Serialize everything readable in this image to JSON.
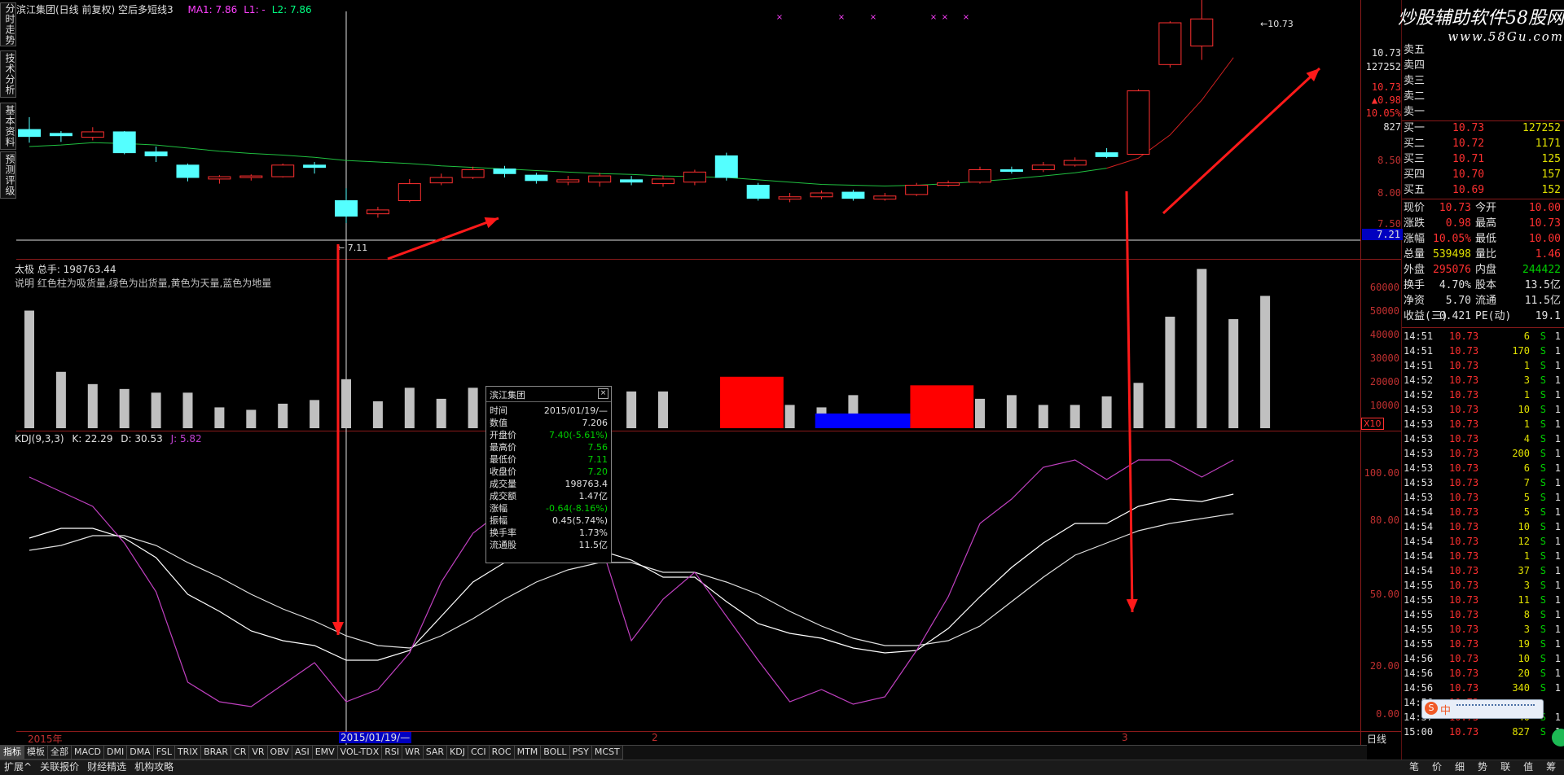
{
  "chart_header": {
    "title": "滨江集团(日线 前复权) 空后多短线3",
    "ma_labels": [
      {
        "text": "MA1: 7.86",
        "color": "#ff40ff"
      },
      {
        "text": "L1: -",
        "color": "#ff40ff"
      },
      {
        "text": "L2: 7.86",
        "color": "#00ff80"
      }
    ]
  },
  "side_tabs": [
    "分时走势",
    "技术分析",
    "基本资料",
    "预测评级"
  ],
  "watermark": {
    "line1": "炒股辅助软件58股网",
    "line2": "www.58Gu.com"
  },
  "price_axis": {
    "ticks": [
      "10.73",
      "127252",
      "10.73",
      "▲0.98",
      "10.05%",
      "827",
      "8.50",
      "8.00",
      "7.50",
      "7.21"
    ]
  },
  "price_chart": {
    "high_label": "10.73",
    "low_label": "← 7.11",
    "x_markers": [
      "×",
      "×",
      "×",
      "×",
      "×",
      "×"
    ],
    "candles": [
      {
        "o": 8.32,
        "c": 8.23,
        "h": 8.48,
        "l": 8.15
      },
      {
        "o": 8.27,
        "c": 8.24,
        "h": 8.3,
        "l": 8.16
      },
      {
        "o": 8.22,
        "c": 8.29,
        "h": 8.35,
        "l": 8.18
      },
      {
        "o": 8.29,
        "c": 8.02,
        "h": 8.3,
        "l": 8.0
      },
      {
        "o": 8.03,
        "c": 7.98,
        "h": 8.1,
        "l": 7.9
      },
      {
        "o": 7.86,
        "c": 7.7,
        "h": 7.88,
        "l": 7.65
      },
      {
        "o": 7.68,
        "c": 7.71,
        "h": 7.73,
        "l": 7.62
      },
      {
        "o": 7.7,
        "c": 7.72,
        "h": 7.74,
        "l": 7.66
      },
      {
        "o": 7.71,
        "c": 7.86,
        "h": 7.88,
        "l": 7.7
      },
      {
        "o": 7.86,
        "c": 7.83,
        "h": 7.9,
        "l": 7.75
      },
      {
        "o": 7.4,
        "c": 7.2,
        "h": 7.56,
        "l": 7.11
      },
      {
        "o": 7.23,
        "c": 7.28,
        "h": 7.32,
        "l": 7.18
      },
      {
        "o": 7.4,
        "c": 7.62,
        "h": 7.68,
        "l": 7.38
      },
      {
        "o": 7.63,
        "c": 7.7,
        "h": 7.75,
        "l": 7.6
      },
      {
        "o": 7.7,
        "c": 7.8,
        "h": 7.84,
        "l": 7.68
      },
      {
        "o": 7.81,
        "c": 7.75,
        "h": 7.85,
        "l": 7.7
      },
      {
        "o": 7.73,
        "c": 7.66,
        "h": 7.76,
        "l": 7.62
      },
      {
        "o": 7.64,
        "c": 7.67,
        "h": 7.72,
        "l": 7.6
      },
      {
        "o": 7.64,
        "c": 7.72,
        "h": 7.76,
        "l": 7.58
      },
      {
        "o": 7.67,
        "c": 7.64,
        "h": 7.72,
        "l": 7.6
      },
      {
        "o": 7.62,
        "c": 7.68,
        "h": 7.72,
        "l": 7.58
      },
      {
        "o": 7.64,
        "c": 7.77,
        "h": 7.8,
        "l": 7.6
      },
      {
        "o": 7.98,
        "c": 7.7,
        "h": 8.02,
        "l": 7.66
      },
      {
        "o": 7.6,
        "c": 7.43,
        "h": 7.63,
        "l": 7.4
      },
      {
        "o": 7.42,
        "c": 7.45,
        "h": 7.5,
        "l": 7.38
      },
      {
        "o": 7.45,
        "c": 7.5,
        "h": 7.53,
        "l": 7.42
      },
      {
        "o": 7.51,
        "c": 7.43,
        "h": 7.54,
        "l": 7.4
      },
      {
        "o": 7.42,
        "c": 7.46,
        "h": 7.5,
        "l": 7.4
      },
      {
        "o": 7.48,
        "c": 7.6,
        "h": 7.63,
        "l": 7.46
      },
      {
        "o": 7.6,
        "c": 7.63,
        "h": 7.66,
        "l": 7.58
      },
      {
        "o": 7.64,
        "c": 7.8,
        "h": 7.84,
        "l": 7.62
      },
      {
        "o": 7.8,
        "c": 7.78,
        "h": 7.84,
        "l": 7.75
      },
      {
        "o": 7.8,
        "c": 7.86,
        "h": 7.9,
        "l": 7.77
      },
      {
        "o": 7.86,
        "c": 7.92,
        "h": 7.96,
        "l": 7.84
      },
      {
        "o": 8.02,
        "c": 7.97,
        "h": 8.08,
        "l": 7.95
      },
      {
        "o": 8.0,
        "c": 8.82,
        "h": 8.84,
        "l": 8.0
      },
      {
        "o": 9.16,
        "c": 9.7,
        "h": 9.72,
        "l": 9.12
      },
      {
        "o": 9.4,
        "c": 9.75,
        "h": 10.05,
        "l": 9.22
      },
      {
        "o": 10.23,
        "c": 10.73,
        "h": 10.73,
        "l": 10.12
      }
    ],
    "ma_line": [
      8.1,
      8.12,
      8.15,
      8.14,
      8.12,
      8.08,
      8.04,
      8.01,
      7.99,
      7.96,
      7.92,
      7.9,
      7.88,
      7.85,
      7.83,
      7.81,
      7.79,
      7.77,
      7.75,
      7.74,
      7.72,
      7.71,
      7.7,
      7.67,
      7.64,
      7.61,
      7.6,
      7.59,
      7.6,
      7.62,
      7.65,
      7.68,
      7.72,
      7.76,
      7.82,
      7.95,
      8.25,
      8.7,
      9.25
    ]
  },
  "volume_panel": {
    "title": "太极 总手: 198763.44",
    "desc": "说明 红色柱为吸货量,绿色为出货量,黄色为天量,蓝色为地量",
    "ticks": [
      "60000",
      "50000",
      "40000",
      "30000",
      "20000",
      "10000"
    ],
    "unit_label": "X10",
    "bars": [
      48000,
      23000,
      18000,
      16000,
      14500,
      14500,
      8500,
      7500,
      10000,
      11500,
      20000,
      11000,
      16500,
      12000,
      16500,
      17000,
      13000,
      17000,
      14500,
      15000,
      15000,
      14500,
      9000,
      8500,
      9500,
      8500,
      13500,
      14500,
      15000,
      12500,
      12000,
      13500,
      9500,
      9500,
      13000,
      18500,
      45500,
      65000,
      44500,
      54000
    ],
    "blocks": [
      {
        "from": 21.8,
        "to": 23.8,
        "value": 21000,
        "color": "#ff0000"
      },
      {
        "from": 24.8,
        "to": 27.8,
        "value": 6000,
        "color": "#0000ff"
      },
      {
        "from": 27.8,
        "to": 29.8,
        "value": 17500,
        "color": "#ff0000"
      }
    ]
  },
  "kdj_panel": {
    "title": "KDJ(9,3,3)",
    "k_label": "K: 22.29",
    "d_label": "D: 30.53",
    "j_label": "J: 5.82",
    "ticks": [
      "100.00",
      "80.00",
      "50.00",
      "20.00",
      "0.00"
    ],
    "k": [
      72,
      76,
      76,
      72,
      64,
      49,
      42,
      34,
      30,
      28,
      22,
      22,
      26,
      40,
      54,
      62,
      65,
      66,
      67,
      63,
      56,
      56,
      46,
      37,
      33,
      31,
      27,
      25,
      26,
      35,
      48,
      60,
      70,
      78,
      78,
      85,
      88,
      87,
      90
    ],
    "d": [
      67,
      69,
      73,
      73,
      69,
      62,
      56,
      49,
      43,
      38,
      32,
      28,
      27,
      32,
      39,
      47,
      54,
      59,
      62,
      62,
      58,
      58,
      54,
      49,
      42,
      36,
      31,
      28,
      28,
      30,
      36,
      46,
      56,
      65,
      70,
      75,
      78,
      80,
      82
    ],
    "j": [
      97,
      91,
      85,
      70,
      50,
      13,
      5,
      3,
      12,
      21,
      5,
      10,
      25,
      54,
      74,
      84,
      86,
      82,
      71,
      30,
      47,
      58,
      40,
      22,
      5,
      10,
      4,
      7,
      26,
      48,
      78,
      88,
      101,
      104,
      96,
      104,
      104,
      97,
      104
    ]
  },
  "date_axis": {
    "labels": [
      "2015年",
      "2015/01/19/—",
      "2",
      "3"
    ],
    "period": "日线"
  },
  "bottom_tabs": [
    "指标",
    "模板",
    "全部",
    "MACD",
    "DMI",
    "DMA",
    "FSL",
    "TRIX",
    "BRAR",
    "CR",
    "VR",
    "OBV",
    "ASI",
    "EMV",
    "VOL-TDX",
    "RSI",
    "WR",
    "SAR",
    "KDJ",
    "CCI",
    "ROC",
    "MTM",
    "BOLL",
    "PSY",
    "MCST"
  ],
  "footer_tabs": [
    "扩展^",
    "关联报价",
    "财经精选",
    "机构攻略"
  ],
  "tooltip": {
    "title": "滨江集团",
    "rows": [
      {
        "label": "时间",
        "value": "2015/01/19/—",
        "color": "#e0e0e0"
      },
      {
        "label": "数值",
        "value": "7.206",
        "color": "#e0e0e0"
      },
      {
        "label": "开盘价",
        "value": "7.40(-5.61%)",
        "color": "#00d000"
      },
      {
        "label": "最高价",
        "value": "7.56",
        "color": "#00d000"
      },
      {
        "label": "最低价",
        "value": "7.11",
        "color": "#00d000"
      },
      {
        "label": "收盘价",
        "value": "7.20",
        "color": "#00d000"
      },
      {
        "label": "成交量",
        "value": "198763.4",
        "color": "#e0e0e0"
      },
      {
        "label": "成交额",
        "value": "1.47亿",
        "color": "#e0e0e0"
      },
      {
        "label": "涨幅",
        "value": "-0.64(-8.16%)",
        "color": "#00d000"
      },
      {
        "label": "振幅",
        "value": "0.45(5.74%)",
        "color": "#e0e0e0"
      },
      {
        "label": "换手率",
        "value": "1.73%",
        "color": "#e0e0e0"
      },
      {
        "label": "流通股",
        "value": "11.5亿",
        "color": "#e0e0e0"
      }
    ]
  },
  "order_book": {
    "sell": [
      {
        "label": "卖五"
      },
      {
        "label": "卖四"
      },
      {
        "label": "卖三"
      },
      {
        "label": "卖二"
      },
      {
        "label": "卖一"
      }
    ],
    "buy": [
      {
        "label": "买一",
        "price": "10.73",
        "vol": "127252"
      },
      {
        "label": "买二",
        "price": "10.72",
        "vol": "1171"
      },
      {
        "label": "买三",
        "price": "10.71",
        "vol": "125"
      },
      {
        "label": "买四",
        "price": "10.70",
        "vol": "157"
      },
      {
        "label": "买五",
        "price": "10.69",
        "vol": "152"
      }
    ]
  },
  "stats": [
    {
      "l1": "现价",
      "v1": "10.73",
      "c1": "#ff3030",
      "l2": "今开",
      "v2": "10.00",
      "c2": "#ff3030"
    },
    {
      "l1": "涨跌",
      "v1": "0.98",
      "c1": "#ff3030",
      "l2": "最高",
      "v2": "10.73",
      "c2": "#ff3030"
    },
    {
      "l1": "涨幅",
      "v1": "10.05%",
      "c1": "#ff3030",
      "l2": "最低",
      "v2": "10.00",
      "c2": "#ff3030"
    },
    {
      "l1": "总量",
      "v1": "539498",
      "c1": "#e0e000",
      "l2": "量比",
      "v2": "1.46",
      "c2": "#ff3030"
    },
    {
      "l1": "外盘",
      "v1": "295076",
      "c1": "#ff3030",
      "l2": "内盘",
      "v2": "244422",
      "c2": "#00d000"
    },
    {
      "l1": "换手",
      "v1": "4.70%",
      "c1": "#e0e0e0",
      "l2": "股本",
      "v2": "13.5亿",
      "c2": "#e0e0e0"
    },
    {
      "l1": "净资",
      "v1": "5.70",
      "c1": "#e0e0e0",
      "l2": "流通",
      "v2": "11.5亿",
      "c2": "#e0e0e0"
    },
    {
      "l1": "收益(三)",
      "v1": "0.421",
      "c1": "#e0e0e0",
      "l2": "PE(动)",
      "v2": "19.1",
      "c2": "#e0e0e0"
    }
  ],
  "ticks": [
    {
      "t": "14:51",
      "p": "10.73",
      "v": "6",
      "s": "S"
    },
    {
      "t": "14:51",
      "p": "10.73",
      "v": "170",
      "s": "S"
    },
    {
      "t": "14:51",
      "p": "10.73",
      "v": "1",
      "s": "S"
    },
    {
      "t": "14:52",
      "p": "10.73",
      "v": "3",
      "s": "S"
    },
    {
      "t": "14:52",
      "p": "10.73",
      "v": "1",
      "s": "S"
    },
    {
      "t": "14:53",
      "p": "10.73",
      "v": "10",
      "s": "S"
    },
    {
      "t": "14:53",
      "p": "10.73",
      "v": "1",
      "s": "S"
    },
    {
      "t": "14:53",
      "p": "10.73",
      "v": "4",
      "s": "S"
    },
    {
      "t": "14:53",
      "p": "10.73",
      "v": "200",
      "s": "S"
    },
    {
      "t": "14:53",
      "p": "10.73",
      "v": "6",
      "s": "S"
    },
    {
      "t": "14:53",
      "p": "10.73",
      "v": "7",
      "s": "S"
    },
    {
      "t": "14:53",
      "p": "10.73",
      "v": "5",
      "s": "S"
    },
    {
      "t": "14:54",
      "p": "10.73",
      "v": "5",
      "s": "S"
    },
    {
      "t": "14:54",
      "p": "10.73",
      "v": "10",
      "s": "S"
    },
    {
      "t": "14:54",
      "p": "10.73",
      "v": "12",
      "s": "S"
    },
    {
      "t": "14:54",
      "p": "10.73",
      "v": "1",
      "s": "S"
    },
    {
      "t": "14:54",
      "p": "10.73",
      "v": "37",
      "s": "S"
    },
    {
      "t": "14:55",
      "p": "10.73",
      "v": "3",
      "s": "S"
    },
    {
      "t": "14:55",
      "p": "10.73",
      "v": "11",
      "s": "S"
    },
    {
      "t": "14:55",
      "p": "10.73",
      "v": "8",
      "s": "S"
    },
    {
      "t": "14:55",
      "p": "10.73",
      "v": "3",
      "s": "S"
    },
    {
      "t": "14:55",
      "p": "10.73",
      "v": "19",
      "s": "S"
    },
    {
      "t": "14:56",
      "p": "10.73",
      "v": "10",
      "s": "S"
    },
    {
      "t": "14:56",
      "p": "10.73",
      "v": "20",
      "s": "S"
    },
    {
      "t": "14:56",
      "p": "10.73",
      "v": "340",
      "s": "S"
    },
    {
      "t": "14:56",
      "p": "10.73",
      "v": "",
      "s": ""
    },
    {
      "t": "14:57",
      "p": "10.73",
      "v": "40",
      "s": "S"
    },
    {
      "t": "15:00",
      "p": "10.73",
      "v": "827",
      "s": "S"
    }
  ],
  "ime_toolbar": {
    "label": "中"
  },
  "right_footer": [
    "笔",
    "价",
    "细",
    "势",
    "联",
    "值",
    "筹"
  ]
}
